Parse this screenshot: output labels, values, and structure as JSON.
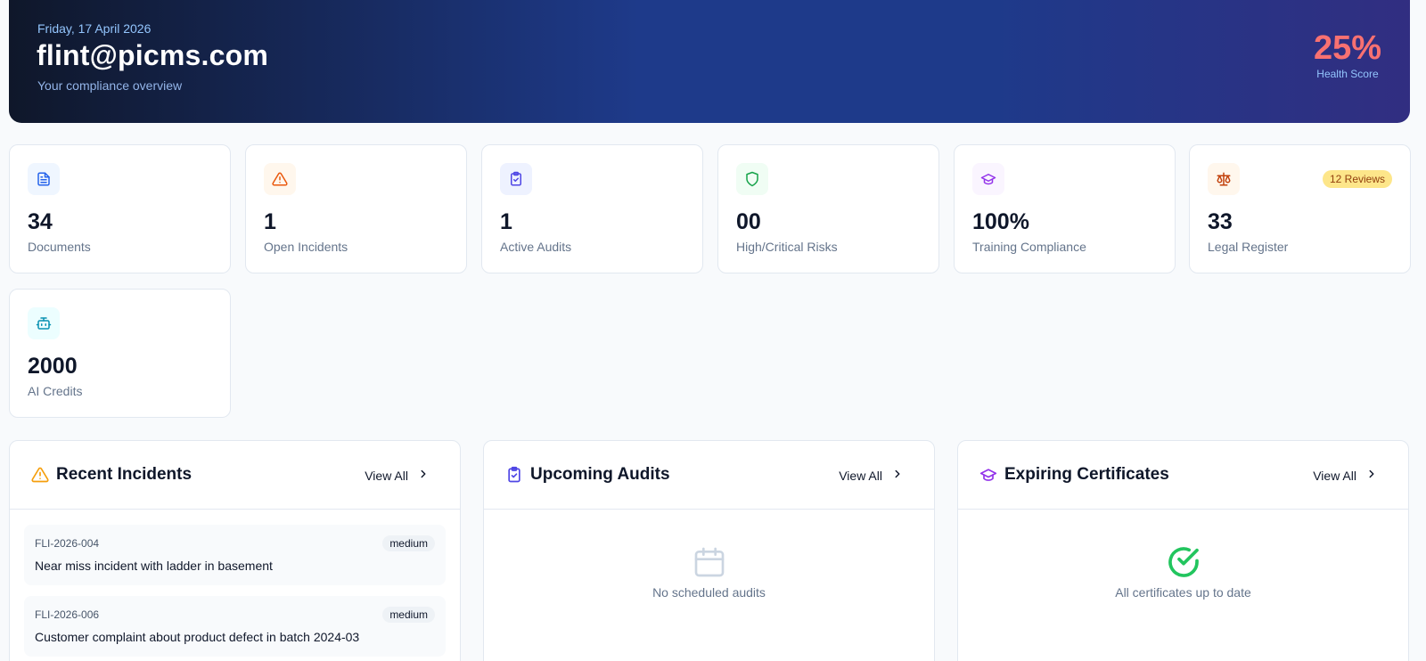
{
  "header": {
    "date": "Friday, 17 April 2026",
    "email": "flint@picms.com",
    "subtitle": "Your compliance overview",
    "health_score": "25%",
    "health_label": "Health Score"
  },
  "stats": [
    {
      "value": "34",
      "label": "Documents",
      "icon": "document-icon",
      "color": "#2563eb",
      "bg": "#eff6ff"
    },
    {
      "value": "1",
      "label": "Open Incidents",
      "icon": "warning-icon",
      "color": "#ea580c",
      "bg": "#fff7ed"
    },
    {
      "value": "1",
      "label": "Active Audits",
      "icon": "clipboard-check-icon",
      "color": "#4f46e5",
      "bg": "#eef2ff"
    },
    {
      "value": "00",
      "label": "High/Critical Risks",
      "icon": "shield-icon",
      "color": "#16a34a",
      "bg": "#f0fdf4"
    },
    {
      "value": "100%",
      "label": "Training Compliance",
      "icon": "graduation-cap-icon",
      "color": "#9333ea",
      "bg": "#faf5ff"
    },
    {
      "value": "33",
      "label": "Legal Register",
      "icon": "scale-icon",
      "color": "#c2410c",
      "bg": "#fff7ed",
      "badge": "12 Reviews"
    },
    {
      "value": "2000",
      "label": "AI Credits",
      "icon": "robot-icon",
      "color": "#0891b2",
      "bg": "#ecfeff"
    }
  ],
  "panels": {
    "incidents": {
      "title": "Recent Incidents",
      "view_all": "View All",
      "items": [
        {
          "ref": "FLI-2026-004",
          "severity": "medium",
          "description": "Near miss incident with ladder in basement"
        },
        {
          "ref": "FLI-2026-006",
          "severity": "medium",
          "description": "Customer complaint about product defect in batch 2024-03"
        }
      ]
    },
    "audits": {
      "title": "Upcoming Audits",
      "view_all": "View All",
      "empty_text": "No scheduled audits"
    },
    "certificates": {
      "title": "Expiring Certificates",
      "view_all": "View All",
      "empty_text": "All certificates up to date"
    }
  }
}
